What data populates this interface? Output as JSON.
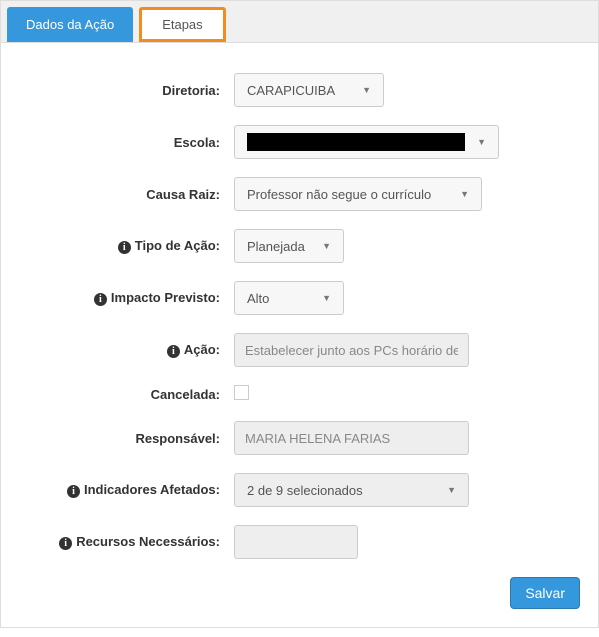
{
  "tabs": {
    "dados": "Dados da Ação",
    "etapas": "Etapas"
  },
  "labels": {
    "diretoria": "Diretoria:",
    "escola": "Escola:",
    "causa_raiz": "Causa Raiz:",
    "tipo_acao": "Tipo de Ação:",
    "impacto_previsto": "Impacto Previsto:",
    "acao": "Ação:",
    "cancelada": "Cancelada:",
    "responsavel": "Responsável:",
    "indicadores": "Indicadores Afetados:",
    "recursos": "Recursos Necessários:"
  },
  "values": {
    "diretoria": "CARAPICUIBA",
    "causa_raiz": "Professor não segue o currículo",
    "tipo_acao": "Planejada",
    "impacto": "Alto",
    "acao": "Estabelecer junto aos PCs horário dec",
    "responsavel": "MARIA HELENA FARIAS",
    "indicadores": "2 de 9 selecionados",
    "recursos": ""
  },
  "buttons": {
    "salvar": "Salvar"
  }
}
